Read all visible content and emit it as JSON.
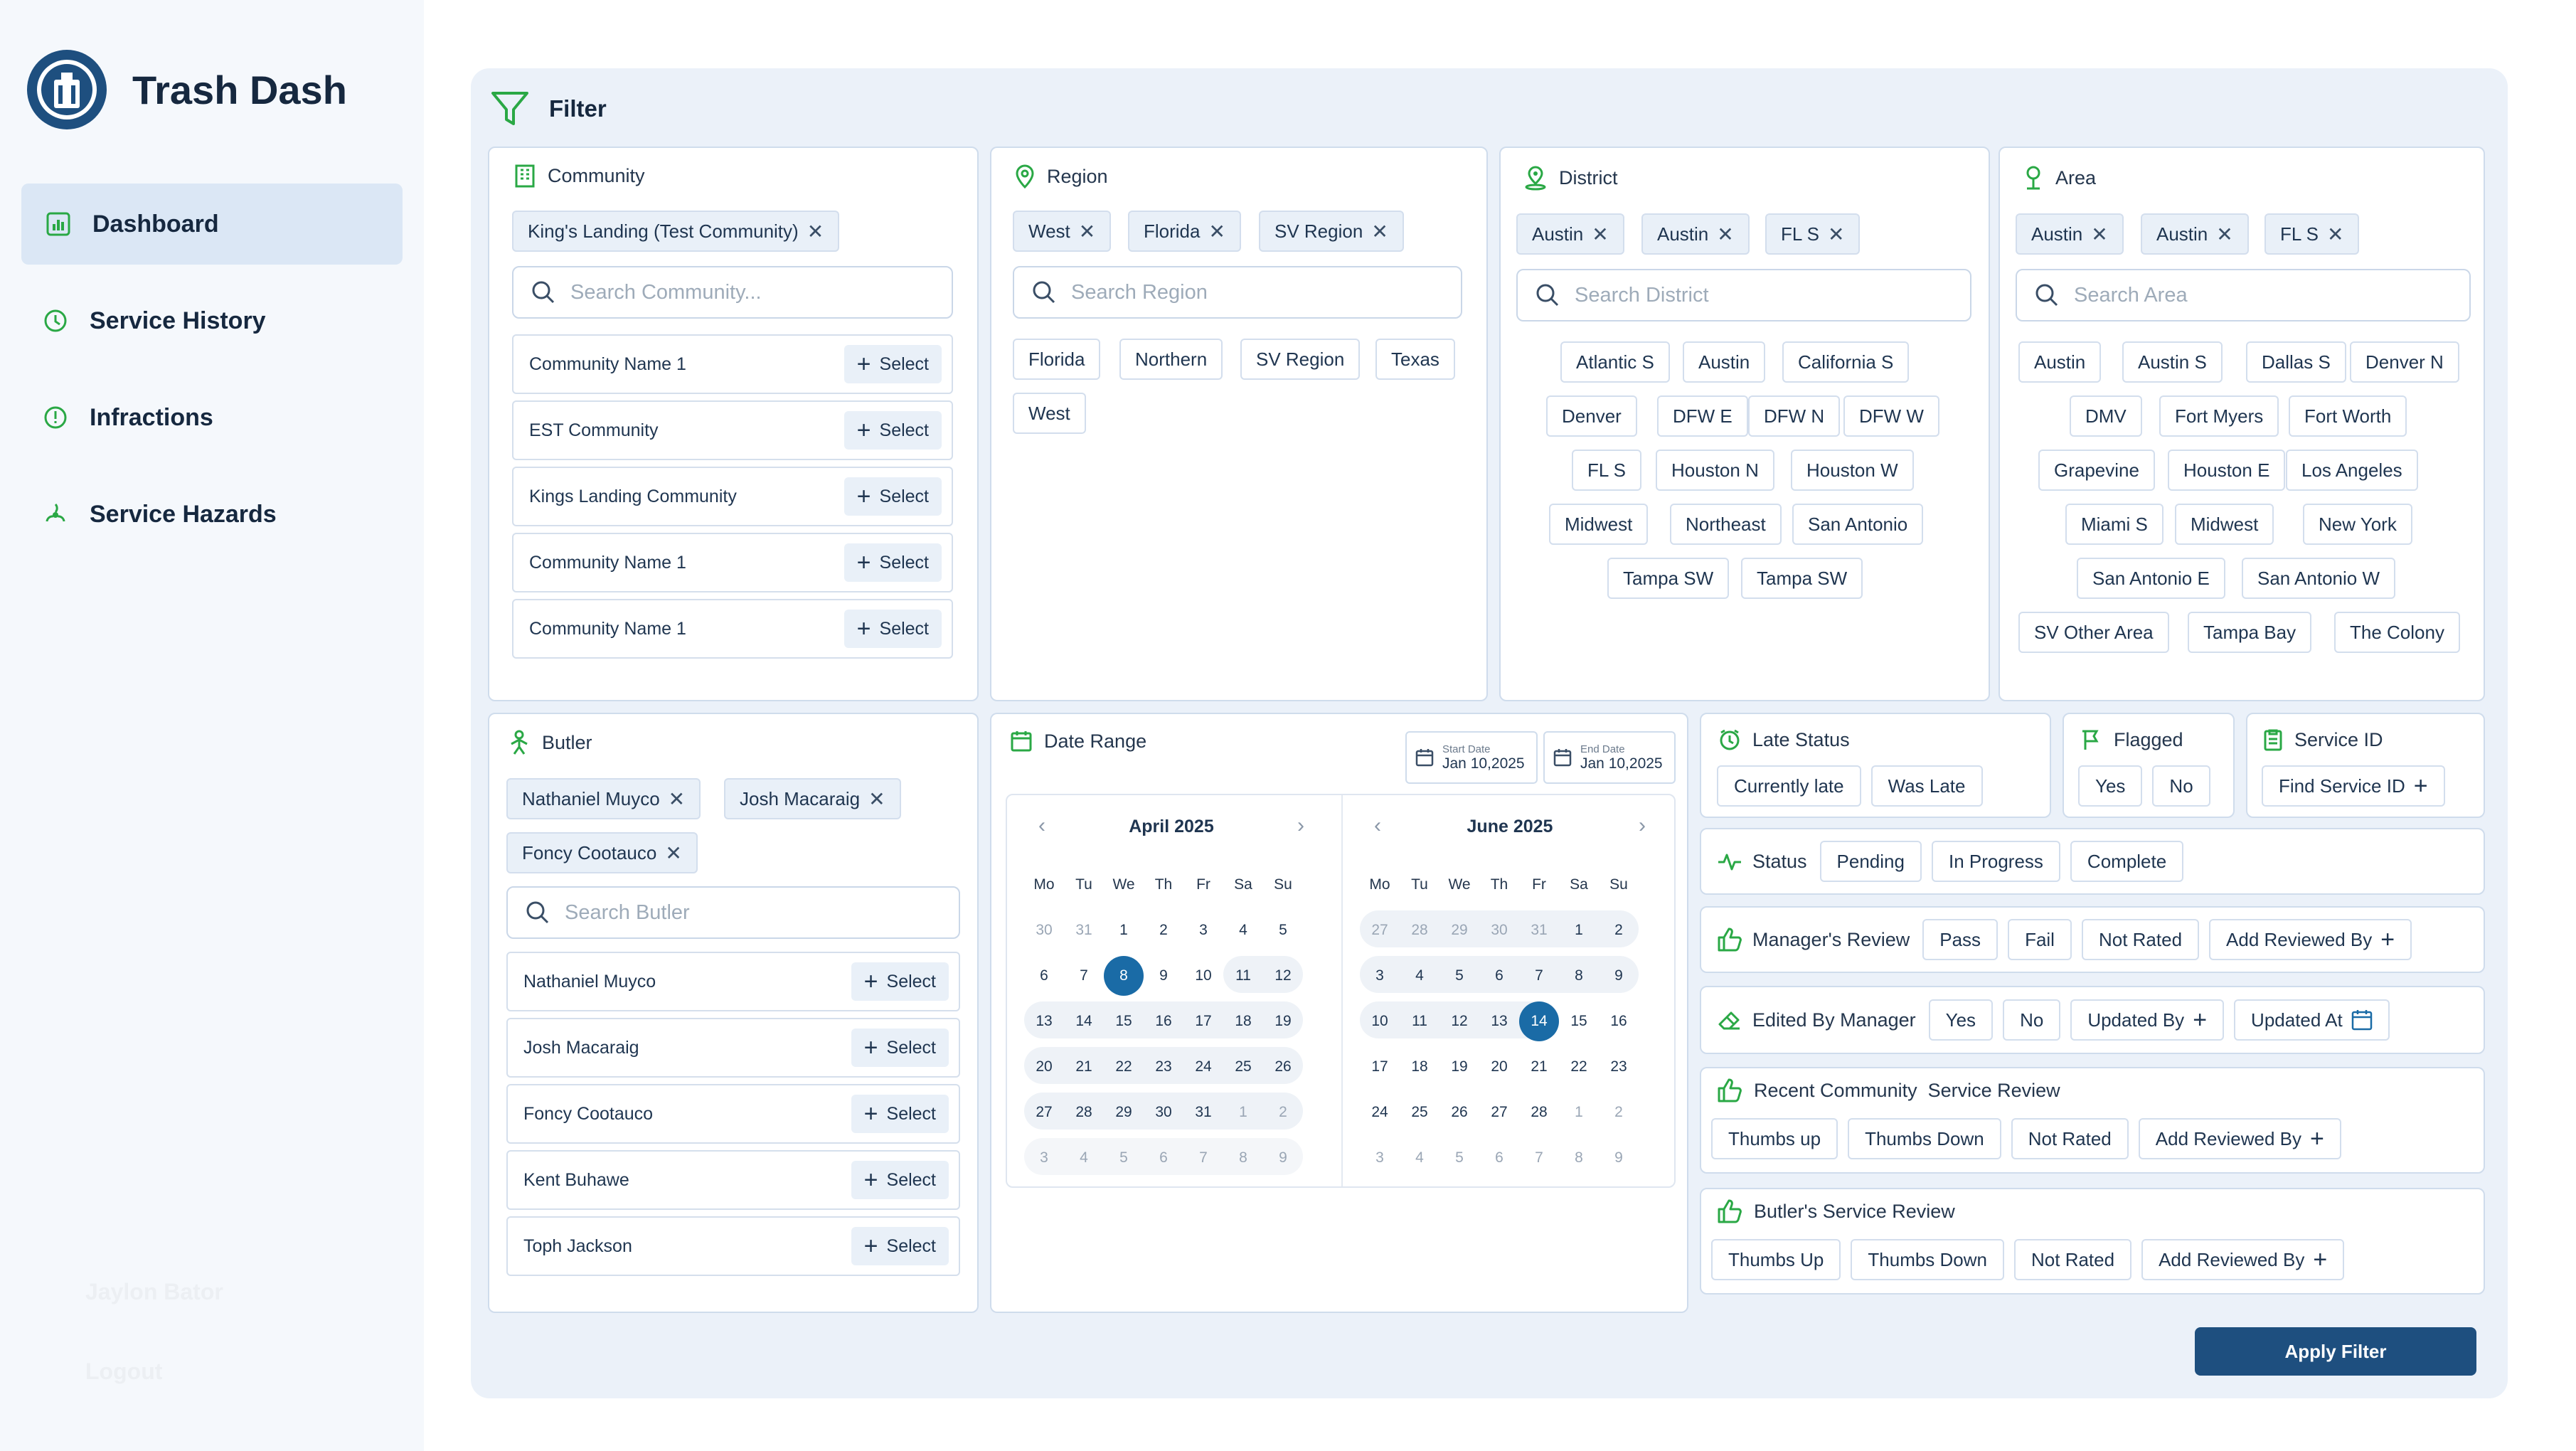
{
  "app": {
    "title": "Trash Dash",
    "logo_text": "TRASH BUTLER DOORSTEP PICKUP"
  },
  "nav": [
    {
      "label": "Dashboard",
      "icon": "bar-chart-icon",
      "active": true
    },
    {
      "label": "Service History",
      "icon": "history-icon"
    },
    {
      "label": "Infractions",
      "icon": "alert-circle-icon"
    },
    {
      "label": "Service Hazards",
      "icon": "hazard-icon"
    }
  ],
  "user": {
    "name": "Jaylon Bator",
    "logout": "Logout"
  },
  "filter": {
    "title": "Filter",
    "apply": "Apply Filter"
  },
  "community": {
    "label": "Community",
    "selected": [
      "King's Landing (Test Community)"
    ],
    "placeholder": "Search Community...",
    "items": [
      "Community Name 1",
      "EST Community",
      "Kings Landing Community",
      "Community Name 1",
      "Community Name 1"
    ],
    "select": "Select"
  },
  "region": {
    "label": "Region",
    "selected": [
      "West",
      "Florida",
      "SV Region"
    ],
    "placeholder": "Search Region",
    "options": [
      "Florida",
      "Northern",
      "SV Region",
      "Texas",
      "West"
    ]
  },
  "district": {
    "label": "District",
    "selected": [
      "Austin",
      "Austin",
      "FL S"
    ],
    "placeholder": "Search District",
    "options": [
      "Atlantic S",
      "Austin",
      "California S",
      "Denver",
      "DFW E",
      "DFW N",
      "DFW W",
      "FL S",
      "Houston N",
      "Houston W",
      "Midwest",
      "Northeast",
      "San Antonio",
      "Tampa SW",
      "Tampa SW"
    ]
  },
  "area": {
    "label": "Area",
    "selected": [
      "Austin",
      "Austin",
      "FL S"
    ],
    "placeholder": "Search Area",
    "options": [
      "Austin",
      "Austin S",
      "Dallas S",
      "Denver N",
      "DMV",
      "Fort Myers",
      "Fort Worth",
      "Grapevine",
      "Houston E",
      "Los Angeles",
      "Miami S",
      "Midwest",
      "New York",
      "San Antonio E",
      "San Antonio W",
      "SV Other Area",
      "Tampa Bay",
      "The Colony"
    ]
  },
  "butler": {
    "label": "Butler",
    "selected": [
      "Nathaniel Muyco",
      "Josh Macaraig",
      "Foncy Cootauco"
    ],
    "placeholder": "Search Butler",
    "items": [
      "Nathaniel Muyco",
      "Josh Macaraig",
      "Foncy Cootauco",
      "Kent Buhawe",
      "Toph Jackson"
    ],
    "select": "Select"
  },
  "date_range": {
    "label": "Date Range",
    "start_label": "Start Date",
    "start": "Jan 10,2025",
    "end_label": "End Date",
    "end": "Jan 10,2025",
    "weekdays": [
      "Mo",
      "Tu",
      "We",
      "Th",
      "Fr",
      "Sa",
      "Su"
    ],
    "cal1": {
      "month": "April 2025",
      "days": [
        "30",
        "31",
        "1",
        "2",
        "3",
        "4",
        "5",
        "6",
        "7",
        "8",
        "9",
        "10",
        "11",
        "12",
        "13",
        "14",
        "15",
        "16",
        "17",
        "18",
        "19",
        "20",
        "21",
        "22",
        "23",
        "24",
        "25",
        "26",
        "27",
        "28",
        "29",
        "30",
        "31",
        "1",
        "2",
        "3",
        "4",
        "5",
        "6",
        "7",
        "8",
        "9"
      ]
    },
    "cal2": {
      "month": "June 2025",
      "days": [
        "27",
        "28",
        "29",
        "30",
        "31",
        "1",
        "2",
        "3",
        "4",
        "5",
        "6",
        "7",
        "8",
        "9",
        "10",
        "11",
        "12",
        "13",
        "14",
        "15",
        "16",
        "17",
        "18",
        "19",
        "20",
        "21",
        "22",
        "23",
        "24",
        "25",
        "26",
        "27",
        "28",
        "1",
        "2",
        "3",
        "4",
        "5",
        "6",
        "7",
        "8",
        "9"
      ]
    }
  },
  "late_status": {
    "label": "Late Status",
    "options": [
      "Currently late",
      "Was Late"
    ]
  },
  "flagged": {
    "label": "Flagged",
    "options": [
      "Yes",
      "No"
    ]
  },
  "service_id": {
    "label": "Service ID",
    "button": "Find Service ID"
  },
  "status": {
    "label": "Status",
    "options": [
      "Pending",
      "In Progress",
      "Complete"
    ]
  },
  "manager_review": {
    "label": "Manager's Review",
    "options": [
      "Pass",
      "Fail",
      "Not Rated"
    ],
    "add": "Add Reviewed By"
  },
  "edited_by_manager": {
    "label": "Edited By Manager",
    "options": [
      "Yes",
      "No"
    ],
    "updated_by": "Updated By",
    "updated_at": "Updated At"
  },
  "community_review": {
    "label": "Recent Community  Service Review",
    "options": [
      "Thumbs up",
      "Thumbs Down",
      "Not Rated"
    ],
    "add": "Add Reviewed By"
  },
  "butler_review": {
    "label": "Butler's Service Review",
    "options": [
      "Thumbs Up",
      "Thumbs Down",
      "Not Rated"
    ],
    "add": "Add Reviewed By"
  },
  "colors": {
    "accent": "#1a6ba6",
    "green": "#2aa845",
    "apply": "#1e4f7f"
  }
}
